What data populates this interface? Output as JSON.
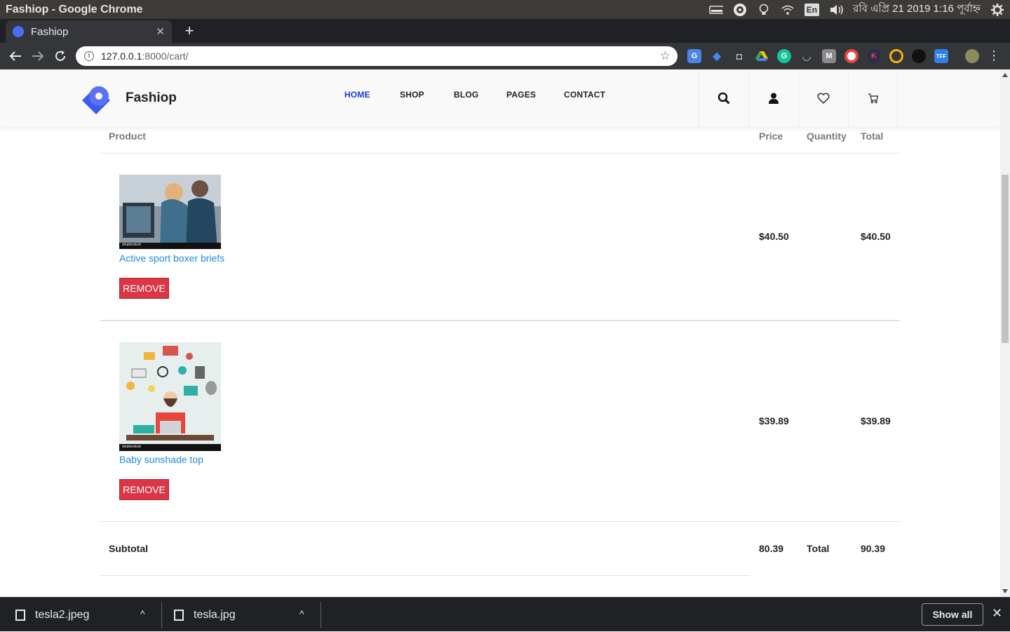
{
  "os": {
    "window_title": "Fashiop - Google Chrome",
    "tray_lang": "En",
    "clock": "রবি এপ্রি 21 2019  1:16 পূর্বাহ্ন"
  },
  "browser": {
    "tab_title": "Fashiop",
    "url_host": "127.0.0.1",
    "url_path": ":8000/cart/"
  },
  "site": {
    "brand": "Fashiop",
    "accent_color": "#1a3bd6",
    "nav": [
      "HOME",
      "SHOP",
      "BLOG",
      "PAGES",
      "CONTACT"
    ]
  },
  "cart": {
    "headers": {
      "product": "Product",
      "price": "Price",
      "quantity": "Quantity",
      "total": "Total"
    },
    "items": [
      {
        "name": "Active sport boxer briefs",
        "price": "$40.50",
        "total": "$40.50",
        "remove_label": "REMOVE",
        "image_watermark": "shutterstock"
      },
      {
        "name": "Baby sunshade top",
        "price": "$39.89",
        "total": "$39.89",
        "remove_label": "REMOVE",
        "image_watermark": "shutterstock"
      }
    ],
    "summary": {
      "subtotal_label": "Subtotal",
      "subtotal_value": "80.39",
      "total_label": "Total",
      "total_value": "90.39"
    }
  },
  "downloads": {
    "items": [
      "tesla2.jpeg",
      "tesla.jpg"
    ],
    "show_all_label": "Show all"
  }
}
